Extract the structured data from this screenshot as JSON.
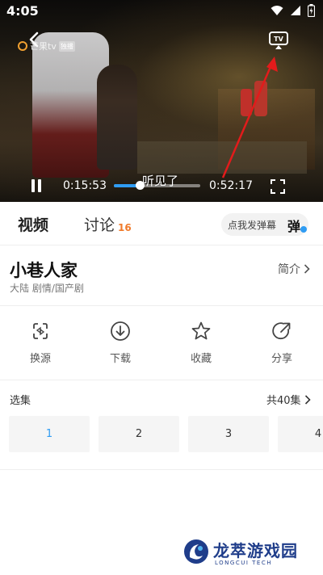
{
  "status_bar": {
    "time": "4:05"
  },
  "player": {
    "channel_logo_text": "芒果tv",
    "channel_logo_tag": "独播",
    "subtitle": "听见了",
    "current_time": "0:15:53",
    "total_time": "0:52:17",
    "progress_fraction": 0.3
  },
  "tabs": {
    "video_label": "视频",
    "discuss_label": "讨论",
    "discuss_count": "16"
  },
  "danmaku": {
    "label": "点我发弹幕",
    "icon_char": "弹"
  },
  "show": {
    "title": "小巷人家",
    "meta": "大陆 剧情/国产剧",
    "intro_label": "简介"
  },
  "actions": [
    {
      "label": "换源",
      "icon": "switch-source-icon"
    },
    {
      "label": "下载",
      "icon": "download-icon"
    },
    {
      "label": "收藏",
      "icon": "star-icon"
    },
    {
      "label": "分享",
      "icon": "share-icon"
    }
  ],
  "episodes": {
    "title": "选集",
    "total_label": "共40集",
    "items": [
      "1",
      "2",
      "3",
      "4"
    ],
    "active_index": 0
  },
  "watermark": {
    "text": "龙萃游戏园",
    "sub": "LONGCUI TECH"
  },
  "colors": {
    "accent": "#2f9cf3",
    "count_orange": "#f07a2a",
    "arrow_red": "#e21b1b"
  }
}
